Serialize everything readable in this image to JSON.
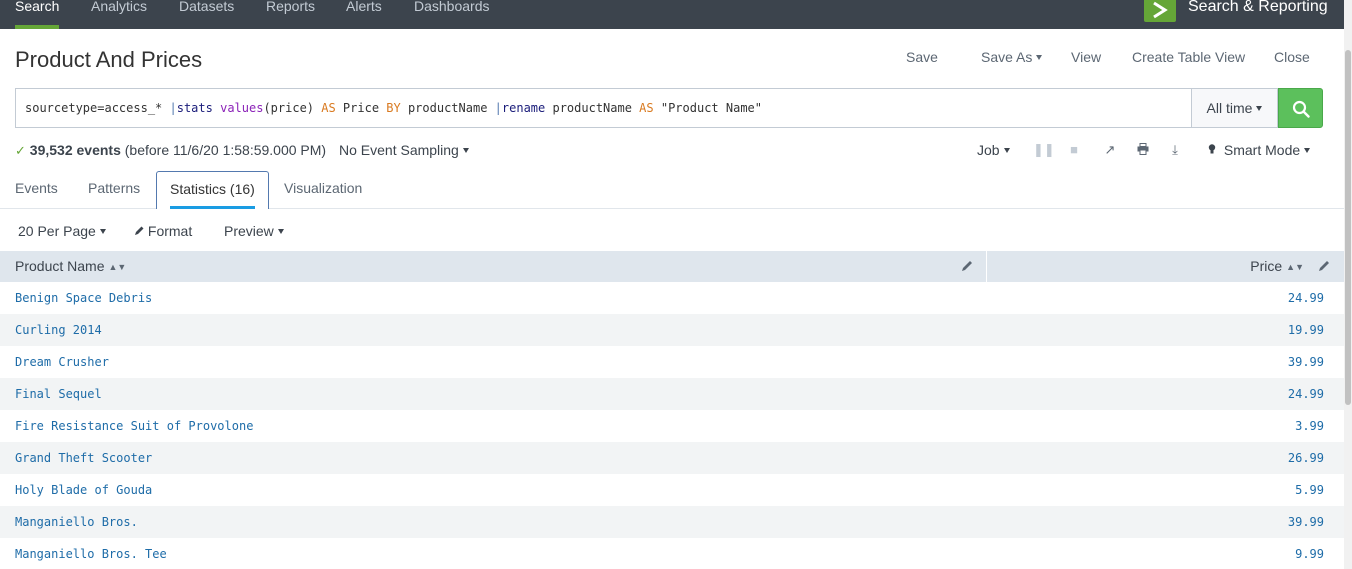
{
  "nav": {
    "items": [
      "Search",
      "Analytics",
      "Datasets",
      "Reports",
      "Alerts",
      "Dashboards"
    ],
    "app_name": "Search & Reporting"
  },
  "page": {
    "title": "Product And Prices",
    "actions": [
      "Save",
      "Save As",
      "View",
      "Create Table View",
      "Close"
    ]
  },
  "search": {
    "query_parts": [
      {
        "t": "sourcetype=access_* ",
        "c": "plain"
      },
      {
        "t": "|",
        "c": "pipe"
      },
      {
        "t": "stats",
        "c": "cmd"
      },
      {
        "t": " ",
        "c": "plain"
      },
      {
        "t": "values",
        "c": "fn"
      },
      {
        "t": "(price) ",
        "c": "plain"
      },
      {
        "t": "AS",
        "c": "kw"
      },
      {
        "t": " Price ",
        "c": "plain"
      },
      {
        "t": "BY",
        "c": "kw"
      },
      {
        "t": " productName ",
        "c": "plain"
      },
      {
        "t": "|",
        "c": "pipe"
      },
      {
        "t": "rename",
        "c": "cmd"
      },
      {
        "t": " productName ",
        "c": "plain"
      },
      {
        "t": "AS",
        "c": "kw"
      },
      {
        "t": " \"Product Name\"",
        "c": "plain"
      }
    ],
    "time_range": "All time"
  },
  "status": {
    "event_count": "39,532 events",
    "event_detail": "(before 11/6/20 1:58:59.000 PM)",
    "sampling": "No Event Sampling",
    "job_label": "Job",
    "mode": "Smart Mode"
  },
  "tabs": [
    "Events",
    "Patterns",
    "Statistics (16)",
    "Visualization"
  ],
  "table_controls": {
    "per_page": "20 Per Page",
    "format": "Format",
    "preview": "Preview"
  },
  "table": {
    "columns": [
      "Product Name",
      "Price"
    ],
    "rows": [
      [
        "Benign Space Debris",
        "24.99"
      ],
      [
        "Curling 2014",
        "19.99"
      ],
      [
        "Dream Crusher",
        "39.99"
      ],
      [
        "Final Sequel",
        "24.99"
      ],
      [
        "Fire Resistance Suit of Provolone",
        "3.99"
      ],
      [
        "Grand Theft Scooter",
        "26.99"
      ],
      [
        "Holy Blade of Gouda",
        "5.99"
      ],
      [
        "Manganiello Bros.",
        "39.99"
      ],
      [
        "Manganiello Bros. Tee",
        "9.99"
      ]
    ]
  },
  "colors": {
    "nav_bg": "#3c444d",
    "accent_green": "#65a637",
    "search_button": "#5cc05c",
    "link_blue": "#1e6ca8",
    "tab_underline": "#1a9ce3"
  }
}
